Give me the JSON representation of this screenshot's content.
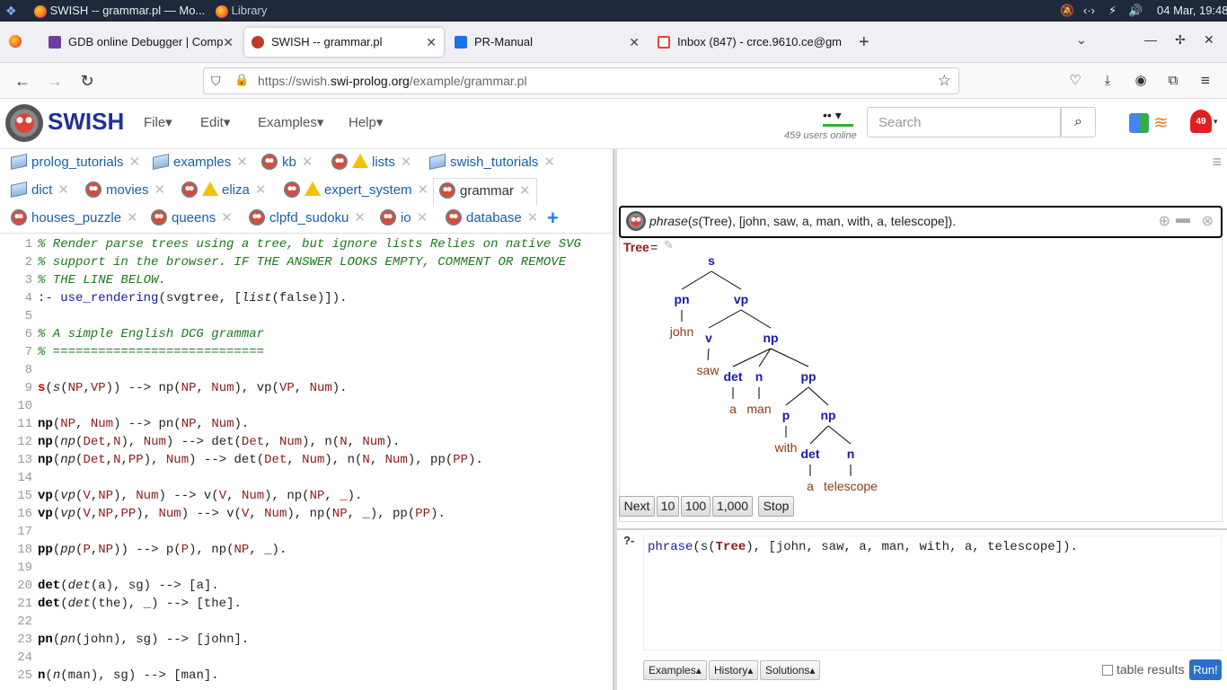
{
  "os_bar": {
    "window1": "SWISH -- grammar.pl — Mo...",
    "window2": "Library",
    "datetime": "04 Mar, 19:48"
  },
  "browser": {
    "tabs": [
      {
        "label": "GDB online Debugger | Comp",
        "icon_color": "#6b3fa0"
      },
      {
        "label": "SWISH -- grammar.pl",
        "icon_color": "#c03a2b"
      },
      {
        "label": "PR-Manual",
        "icon_color": "#1a73e8"
      },
      {
        "label": "Inbox (847) - crce.9610.ce@gm",
        "icon_color": "#ea4335"
      }
    ],
    "url_prefix": "https://swish.",
    "url_host": "swi-prolog.org",
    "url_path": "/example/grammar.pl"
  },
  "swish": {
    "logo": "SWISH",
    "menus": [
      "File",
      "Edit",
      "Examples",
      "Help"
    ],
    "users_online": "459 users online",
    "search_placeholder": "Search",
    "notification_count": "49"
  },
  "file_tabs": {
    "row1": [
      {
        "label": "prolog_tutorials",
        "icon": "notebook-icon"
      },
      {
        "label": "examples",
        "icon": "notebook-icon"
      },
      {
        "label": "kb",
        "icon": "owl-icon"
      },
      {
        "label": "lists",
        "icon": "owl-warn-icon"
      },
      {
        "label": "swish_tutorials",
        "icon": "notebook-icon"
      }
    ],
    "row2": [
      {
        "label": "dict",
        "icon": "notebook-icon"
      },
      {
        "label": "movies",
        "icon": "owl-icon"
      },
      {
        "label": "eliza",
        "icon": "owl-warn-icon"
      },
      {
        "label": "expert_system",
        "icon": "owl-warn-icon"
      },
      {
        "label": "grammar",
        "icon": "owl-icon"
      }
    ],
    "row3": [
      {
        "label": "houses_puzzle",
        "icon": "owl-icon"
      },
      {
        "label": "queens",
        "icon": "owl-icon"
      },
      {
        "label": "clpfd_sudoku",
        "icon": "owl-icon"
      },
      {
        "label": "io",
        "icon": "owl-icon"
      },
      {
        "label": "database",
        "icon": "owl-icon"
      }
    ],
    "add_label": "+"
  },
  "code_lines": [
    {
      "n": "1",
      "html": "<span class=\"cmt\">% Render parse trees using a tree, but ignore lists Relies on native SVG</span>"
    },
    {
      "n": "2",
      "html": "<span class=\"cmt\">% support in the browser. IF THE ANSWER LOOKS EMPTY, COMMENT OR REMOVE</span>"
    },
    {
      "n": "3",
      "html": "<span class=\"cmt\">% THE LINE BELOW.</span>"
    },
    {
      "n": "4",
      "html": ":- <span class=\"fn\">use_rendering</span>(<span class=\"atom\">svgtree</span>, [<span class=\"ital\">list</span>(<span class=\"atom\">false</span>)])."
    },
    {
      "n": "5",
      "html": ""
    },
    {
      "n": "6",
      "html": "<span class=\"cmt\">% A simple English DCG grammar</span>"
    },
    {
      "n": "7",
      "html": "<span class=\"cmt\">% ============================</span>"
    },
    {
      "n": "8",
      "html": ""
    },
    {
      "n": "9",
      "html": "<span class=\"headr\">s</span>(<span class=\"ital\">s</span>(<span class=\"var\">NP</span>,<span class=\"var\">VP</span>)) --> np(<span class=\"var\">NP</span>, <span class=\"var\">Num</span>), vp(<span class=\"var\">VP</span>, <span class=\"var\">Num</span>)."
    },
    {
      "n": "10",
      "html": ""
    },
    {
      "n": "11",
      "html": "<span class=\"head\">np</span>(<span class=\"var\">NP</span>, <span class=\"var\">Num</span>) --> pn(<span class=\"var\">NP</span>, <span class=\"var\">Num</span>)."
    },
    {
      "n": "12",
      "html": "<span class=\"head\">np</span>(<span class=\"ital\">np</span>(<span class=\"var\">Det</span>,<span class=\"var\">N</span>), <span class=\"var\">Num</span>) --> det(<span class=\"var\">Det</span>, <span class=\"var\">Num</span>), n(<span class=\"var\">N</span>, <span class=\"var\">Num</span>)."
    },
    {
      "n": "13",
      "html": "<span class=\"head\">np</span>(<span class=\"ital\">np</span>(<span class=\"var\">Det</span>,<span class=\"var\">N</span>,<span class=\"var\">PP</span>), <span class=\"var\">Num</span>) --> det(<span class=\"var\">Det</span>, <span class=\"var\">Num</span>), n(<span class=\"var\">N</span>, <span class=\"var\">Num</span>), pp(<span class=\"var\">PP</span>)."
    },
    {
      "n": "14",
      "html": ""
    },
    {
      "n": "15",
      "html": "<span class=\"head\">vp</span>(<span class=\"ital\">vp</span>(<span class=\"var\">V</span>,<span class=\"var\">NP</span>), <span class=\"var\">Num</span>) --> v(<span class=\"var\">V</span>, <span class=\"var\">Num</span>), np(<span class=\"var\">NP</span>, <span class=\"var\">_</span>)."
    },
    {
      "n": "16",
      "html": "<span class=\"head\">vp</span>(<span class=\"ital\">vp</span>(<span class=\"var\">V</span>,<span class=\"var\">NP</span>,<span class=\"var\">PP</span>), <span class=\"var\">Num</span>) --> v(<span class=\"var\">V</span>, <span class=\"var\">Num</span>), np(<span class=\"var\">NP</span>, <span class=\"var\">_</span>), pp(<span class=\"var\">PP</span>)."
    },
    {
      "n": "17",
      "html": ""
    },
    {
      "n": "18",
      "html": "<span class=\"head\">pp</span>(<span class=\"ital\">pp</span>(<span class=\"var\">P</span>,<span class=\"var\">NP</span>)) --> p(<span class=\"var\">P</span>), np(<span class=\"var\">NP</span>, <span class=\"var\">_</span>)."
    },
    {
      "n": "19",
      "html": ""
    },
    {
      "n": "20",
      "html": "<span class=\"head\">det</span>(<span class=\"ital\">det</span>(a), <span class=\"atom\">sg</span>) --> [a]."
    },
    {
      "n": "21",
      "html": "<span class=\"head\">det</span>(<span class=\"ital\">det</span>(the), <span class=\"var\">_</span>) --> [the]."
    },
    {
      "n": "22",
      "html": ""
    },
    {
      "n": "23",
      "html": "<span class=\"head\">pn</span>(<span class=\"ital\">pn</span>(john), <span class=\"atom\">sg</span>) --> [john]."
    },
    {
      "n": "24",
      "html": ""
    },
    {
      "n": "25",
      "html": "<span class=\"head\">n</span>(<span class=\"ital\">n</span>(man), <span class=\"atom\">sg</span>) --> [man]."
    }
  ],
  "answer": {
    "query_pred": "phrase",
    "query_rest_a": "(",
    "query_s": "s",
    "query_rest_b": "(Tree), [john, saw, a, man, with, a, telescope]).",
    "var_label": "Tree",
    "eq": " ="
  },
  "tree_nodes": [
    {
      "t": "s",
      "k": "nt"
    },
    {
      "t": "pn",
      "k": "nt"
    },
    {
      "t": "vp",
      "k": "nt"
    },
    {
      "t": "john",
      "k": "lf"
    },
    {
      "t": "v",
      "k": "nt"
    },
    {
      "t": "np",
      "k": "nt"
    },
    {
      "t": "saw",
      "k": "lf"
    },
    {
      "t": "det",
      "k": "nt"
    },
    {
      "t": "n",
      "k": "nt"
    },
    {
      "t": "pp",
      "k": "nt"
    },
    {
      "t": "a",
      "k": "lf"
    },
    {
      "t": "man",
      "k": "lf"
    },
    {
      "t": "p",
      "k": "nt"
    },
    {
      "t": "np",
      "k": "nt"
    },
    {
      "t": "with",
      "k": "lf"
    },
    {
      "t": "det",
      "k": "nt"
    },
    {
      "t": "n",
      "k": "nt"
    },
    {
      "t": "a",
      "k": "lf"
    },
    {
      "t": "telescope",
      "k": "lf"
    }
  ],
  "controls": {
    "next": "Next",
    "n10": "10",
    "n100": "100",
    "n1000": "1,000",
    "stop": "Stop"
  },
  "query": {
    "prompt": "?-",
    "pred": "phrase",
    "open": "(s(",
    "var": "Tree",
    "rest": "), [john, saw, a, man, with, a, telescope]).",
    "examples": "Examples",
    "history": "History",
    "solutions": "Solutions",
    "table_results": "table results",
    "run": "Run!"
  }
}
